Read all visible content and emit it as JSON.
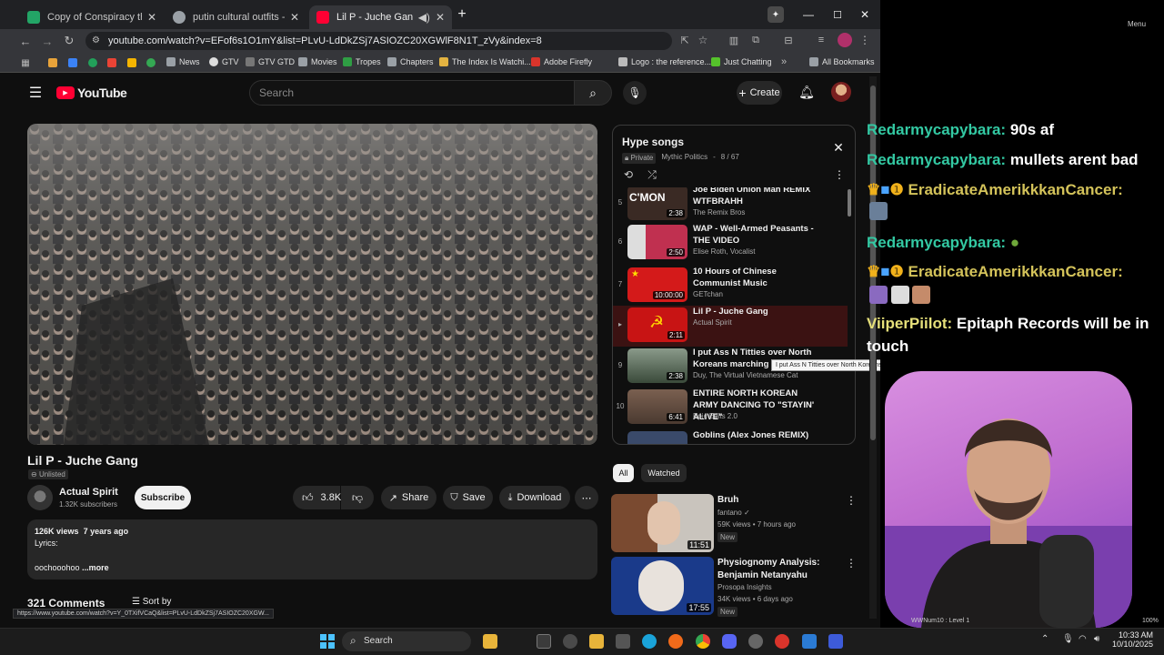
{
  "browser": {
    "tabs": [
      {
        "title": "Copy of Conspiracy theory / tro",
        "color": "#23a566"
      },
      {
        "title": "putin cultural outfits - Google S",
        "color": "#9aa0a6"
      },
      {
        "title": "Lil P - Juche Gang - YouTub",
        "color": "#ff0033"
      }
    ],
    "url": "youtube.com/watch?v=EFof6s1O1mY&list=PLvU-LdDkZSj7ASIOZC20XGWlF8N1T_zVy&index=8",
    "bookmarks": [
      "News",
      "GTV",
      "GTV GTD",
      "Movies",
      "Tropes",
      "Chapters",
      "The Index Is Watchi...",
      "Adobe Firefly",
      "Logo : the reference...",
      "Just Chatting"
    ],
    "all_bookmarks": "All Bookmarks",
    "status_url": "https://www.youtube.com/watch?v=Y_0TXifVCaQ&list=PLvU-LdDkZSj7ASIOZC20XGW..."
  },
  "youtube": {
    "logo": "YouTube",
    "search_placeholder": "Search",
    "create": "Create",
    "video": {
      "title": "Lil P - Juche Gang",
      "visibility": "Unlisted",
      "channel": "Actual Spirit",
      "subscribers": "1.32K subscribers",
      "subscribe": "Subscribe",
      "likes": "3.8K",
      "share": "Share",
      "save": "Save",
      "download": "Download",
      "views": "126K views",
      "age": "7 years ago",
      "desc_line1": "Lyrics:",
      "desc_line2": "oochooohoo",
      "more": "...more",
      "comments": "321 Comments",
      "sort": "Sort by"
    },
    "playlist": {
      "title": "Hype songs",
      "privacy": "Private",
      "owner": "Mythic Politics",
      "position": "8 / 67",
      "tooltip": "I put Ass N Titties over North Koreans marching",
      "items": [
        {
          "num": "5",
          "title": "Joe Biden Union Man REMIX WTFBRAHH",
          "channel": "The Remix Bros",
          "duration": "2:38",
          "thumb": "#3a2a24"
        },
        {
          "num": "6",
          "title": "WAP - Well-Armed Peasants - THE VIDEO",
          "channel": "Elise Roth, Vocalist",
          "duration": "2:50",
          "thumb": "#8a4a5a"
        },
        {
          "num": "7",
          "title": "10 Hours of Chinese Communist Music",
          "channel": "GETchan",
          "duration": "10:00:00",
          "thumb": "#d41a1a"
        },
        {
          "num": "▸",
          "title": "Lil P - Juche Gang",
          "channel": "Actual Spirit",
          "duration": "2:11",
          "thumb": "#c81414"
        },
        {
          "num": "9",
          "title": "I put Ass N Titties over North Koreans marching",
          "channel": "Duy, The Virtual Vietnamese Cat",
          "duration": "2:38",
          "thumb": "#5a6a5a"
        },
        {
          "num": "10",
          "title": "ENTIRE NORTH KOREAN ARMY DANCING TO \"STAYIN' ALIVE\"",
          "channel": "Epic Edits 2.0",
          "duration": "6:41",
          "thumb": "#6a5040"
        },
        {
          "num": "",
          "title": "Goblins (Alex Jones REMIX)",
          "channel": "",
          "duration": "",
          "thumb": "#3a4a6a"
        }
      ]
    },
    "chips": [
      "All",
      "Watched"
    ],
    "recommended": [
      {
        "title": "Bruh",
        "channel": "fantano",
        "views": "59K views",
        "age": "7 hours ago",
        "badge": "New",
        "duration": "11:51",
        "thumb": "#7a5a40"
      },
      {
        "title": "Physiognomy Analysis: Benjamin Netanyahu",
        "channel": "Prosopa Insights",
        "views": "34K views",
        "age": "6 days ago",
        "badge": "New",
        "duration": "17:55",
        "thumb": "#1a3a8a"
      }
    ]
  },
  "chat": {
    "messages": [
      {
        "user": "Redarmycapybara:",
        "text": "90s af",
        "color": "#33c9a3"
      },
      {
        "user": "Redarmycapybara:",
        "text": "mullets arent bad",
        "color": "#33c9a3"
      },
      {
        "user": "EradicateAmerikkkanCancer:",
        "text": "",
        "color": "#d4c35a"
      },
      {
        "user": "Redarmycapybara:",
        "text": "",
        "color": "#33c9a3"
      },
      {
        "user": "EradicateAmerikkkanCancer:",
        "text": "",
        "color": "#d4c35a"
      },
      {
        "user": "ViiperPiilot:",
        "text": "Epitaph Records will be in",
        "color": "#e6e07a"
      },
      {
        "user": "",
        "text": "touch",
        "color": "#ffffff"
      }
    ],
    "right_label": "Menu"
  },
  "taskbar": {
    "search": "Search",
    "time": "10:33 AM",
    "date": "10/10/2025",
    "status_user": "WWNum10 : Level 1",
    "zoom": "100%"
  }
}
